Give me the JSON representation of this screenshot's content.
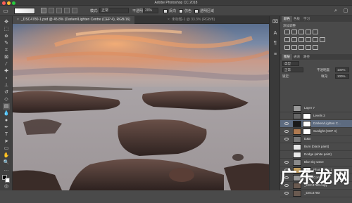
{
  "app": {
    "window_title": "Adobe Photoshop CC 2018"
  },
  "options_bar": {
    "mode_label": "模式:",
    "mode_value": "正常",
    "opacity_label": "不透明度:",
    "opacity_value": "20%",
    "reverse_label": "反向",
    "dither_label": "仿色",
    "transparency_label": "透明区域"
  },
  "tabs": [
    {
      "label": "_DSC4780-1.psd @ 45.8% (Darken/Lighten Centre (CEP 4), RGB/16)",
      "active": true
    },
    {
      "label": "未标题-1 @ 33.3% (RGB/8)",
      "active": false
    }
  ],
  "panels": {
    "tabs_top": [
      "颜色",
      "色板",
      "学习"
    ],
    "adjustments_title": "添加调整",
    "layers_tabs": [
      "图层",
      "通道",
      "路径"
    ],
    "kind_label": "类型",
    "blend_mode": "正常",
    "opacity_label": "不透明度:",
    "opacity_value": "100%",
    "lock_label": "锁定:",
    "fill_label": "填充:",
    "fill_value": "100%"
  },
  "layers": [
    {
      "name": "Layer 7",
      "visible": false,
      "has_mask": false,
      "thumb": "#999999"
    },
    {
      "name": "Levels 3",
      "visible": false,
      "has_mask": true,
      "thumb": "#666666"
    },
    {
      "name": "Darken/Lighten C...",
      "visible": true,
      "has_mask": true,
      "thumb": "#1a1a1a",
      "selected": true
    },
    {
      "name": "Sunlight (CEP 4)",
      "visible": true,
      "has_mask": true,
      "thumb": "#b07a50"
    },
    {
      "name": "D&B",
      "visible": true,
      "has_mask": false,
      "thumb": "#777777",
      "group": true
    },
    {
      "name": "Burn (black paint)",
      "visible": false,
      "has_mask": false,
      "thumb": "#e8e8e8"
    },
    {
      "name": "Dodge (white paint)",
      "visible": false,
      "has_mask": false,
      "thumb": "#e8e8e8"
    },
    {
      "name": "Blur sky wave",
      "visible": true,
      "has_mask": false,
      "thumb": "#8a8a8a"
    },
    {
      "name": "Photo Filter 1",
      "visible": true,
      "has_mask": true,
      "thumb": "#c4a060"
    },
    {
      "name": "Tones/Contr...",
      "visible": true,
      "has_mask": false,
      "thumb": "#9a9a9a"
    },
    {
      "name": "_DSC4780 copy",
      "visible": true,
      "has_mask": false,
      "thumb": "#6a5a50"
    },
    {
      "name": "_DSC4780",
      "visible": true,
      "has_mask": false,
      "thumb": "#6a5a50"
    }
  ],
  "watermark": "广东龙网",
  "colors": {
    "chrome_dark": "#3c3c3c",
    "panel_bg": "#4a4a4a",
    "selected_row": "#5d6b80",
    "sky_orange": "#e9935c",
    "sky_blue": "#6d88a8"
  }
}
